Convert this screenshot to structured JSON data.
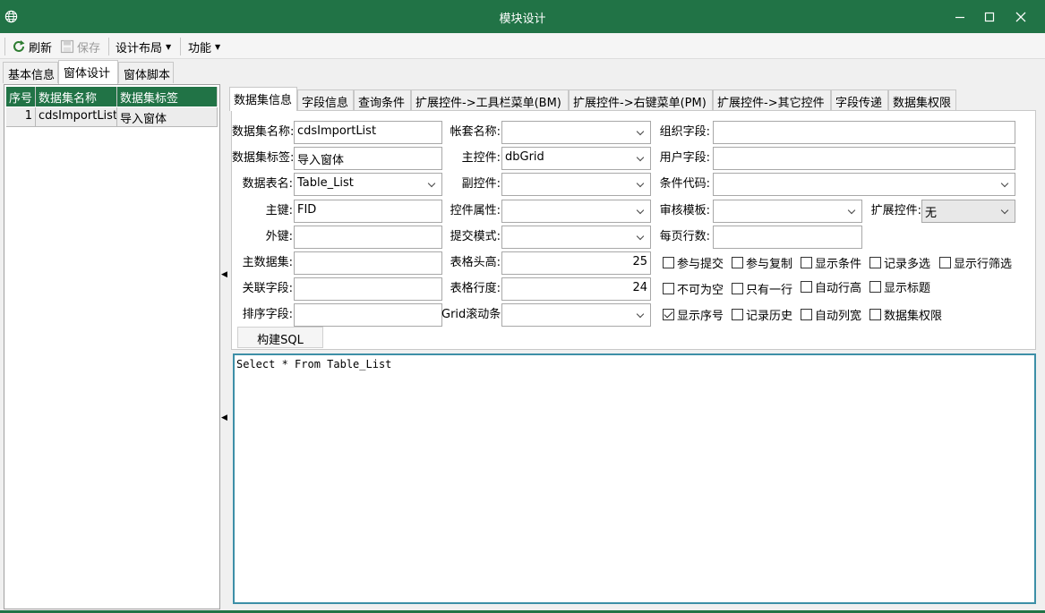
{
  "window": {
    "title": "模块设计"
  },
  "toolbar": {
    "refresh": "刷新",
    "save": "保存",
    "layout": "设计布局",
    "function": "功能"
  },
  "top_tabs": [
    "基本信息",
    "窗体设计",
    "窗体脚本"
  ],
  "left_table": {
    "headers": [
      "序号",
      "数据集名称",
      "数据集标签"
    ],
    "rows": [
      [
        "1",
        "cdsImportList",
        "导入窗体"
      ]
    ]
  },
  "right_tabs": [
    "数据集信息",
    "字段信息",
    "查询条件",
    "扩展控件->工具栏菜单(BM)",
    "扩展控件->右键菜单(PM)",
    "扩展控件->其它控件",
    "字段传递",
    "数据集权限"
  ],
  "form": {
    "col1": {
      "labels": [
        "数据集名称:",
        "数据集标签:",
        "数据表名:",
        "主键:",
        "外键:",
        "主数据集:",
        "关联字段:",
        "排序字段:"
      ],
      "values": [
        "cdsImportList",
        "导入窗体",
        "Table_List",
        "FID",
        "",
        "",
        "",
        ""
      ]
    },
    "col2": {
      "labels": [
        "帐套名称:",
        "主控件:",
        "副控件:",
        "控件属性:",
        "提交模式:",
        "表格头高:",
        "表格行度:",
        "Grid滚动条:"
      ],
      "values": [
        "",
        "dbGrid",
        "",
        "",
        "",
        "25",
        "24",
        ""
      ]
    },
    "col3": {
      "labels": [
        "组织字段:",
        "用户字段:",
        "条件代码:",
        "审核模板:",
        "每页行数:"
      ],
      "values": [
        "",
        "",
        "",
        "",
        ""
      ]
    },
    "ext_label": "扩展控件:",
    "ext_value": "无",
    "checkboxes": [
      {
        "label": "参与提交",
        "checked": false
      },
      {
        "label": "参与复制",
        "checked": false
      },
      {
        "label": "显示条件",
        "checked": false
      },
      {
        "label": "记录多选",
        "checked": false
      },
      {
        "label": "显示行筛选",
        "checked": false
      },
      {
        "label": "不可为空",
        "checked": false
      },
      {
        "label": "只有一行",
        "checked": false
      },
      {
        "label": "自动行高",
        "checked": false
      },
      {
        "label": "显示标题",
        "checked": false
      },
      {
        "label": "显示序号",
        "checked": true
      },
      {
        "label": "记录历史",
        "checked": false
      },
      {
        "label": "自动列宽",
        "checked": false
      },
      {
        "label": "数据集权限",
        "checked": false
      }
    ],
    "build_sql": "构建SQL"
  },
  "sql": "Select * From Table_List"
}
